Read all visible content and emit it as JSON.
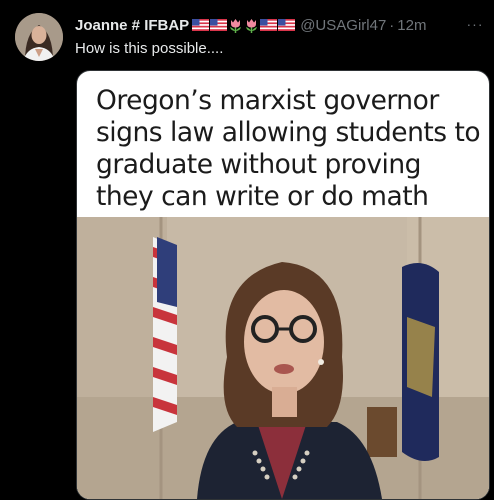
{
  "tweet": {
    "display_name": "Joanne # IFBAP",
    "name_emojis": [
      "flag-us-icon",
      "flag-us-icon",
      "tulip-icon",
      "tulip-icon",
      "flag-us-icon",
      "flag-us-icon"
    ],
    "handle": "@USAGirl47",
    "separator": "·",
    "timestamp": "12m",
    "more_label": "···",
    "text": "How is this possible....",
    "media": {
      "headline": "Oregon’s marxist governor signs law allowing students to graduate without proving they can write or do math",
      "photo_subject": "woman-with-glasses-speaking-photo"
    }
  },
  "colors": {
    "background": "#000000",
    "primary_text": "#e7e9ea",
    "secondary_text": "#71767b",
    "media_border": "#2f3336",
    "headline_text": "#1b1b1b"
  }
}
